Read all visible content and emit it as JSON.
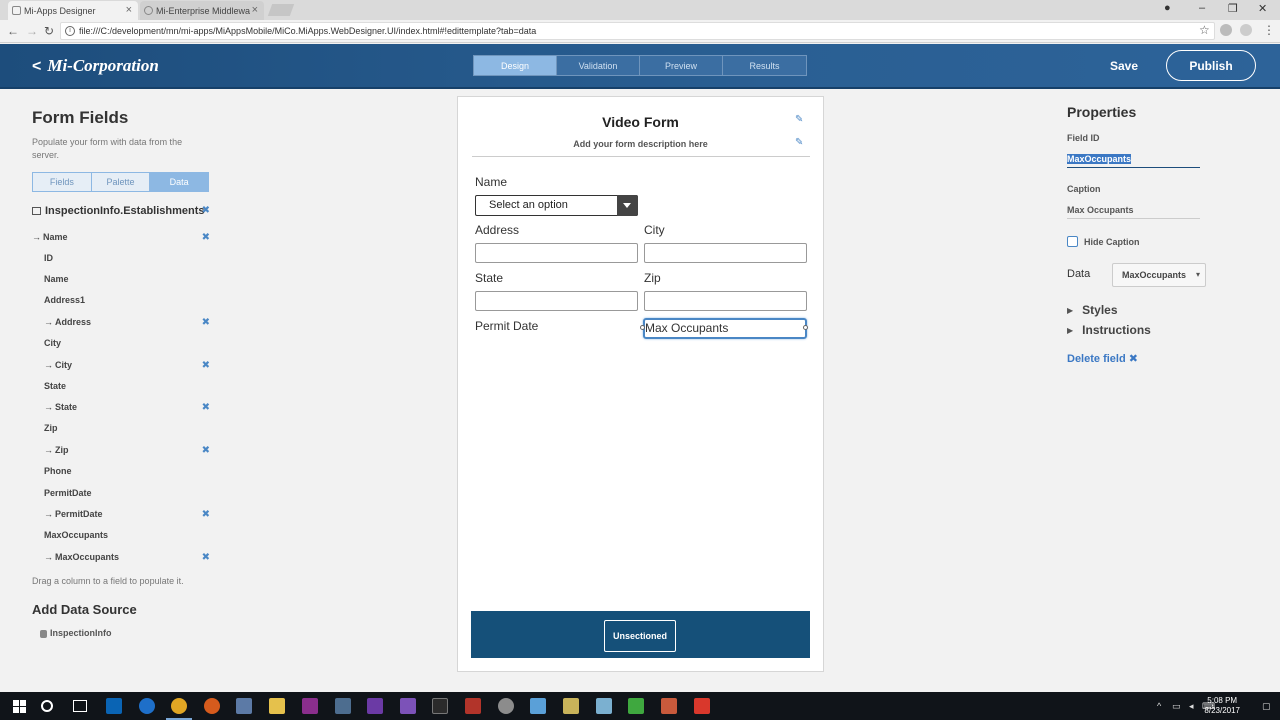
{
  "browser": {
    "tabs": [
      {
        "title": "Mi-Apps Designer"
      },
      {
        "title": "Mi-Enterprise Middlewa"
      }
    ],
    "url": "file:///C:/development/mn/mi-apps/MiAppsMobile/MiCo.MiApps.WebDesigner.UI/index.html#!edittemplate?tab=data"
  },
  "header": {
    "brand": "Mi-Corporation",
    "tabs": [
      "Design",
      "Validation",
      "Preview",
      "Results"
    ],
    "save_label": "Save",
    "publish_label": "Publish"
  },
  "left_panel": {
    "title": "Form Fields",
    "description": "Populate your form with data from the server.",
    "segments": [
      "Fields",
      "Palette",
      "Data"
    ],
    "source_root": "InspectionInfo.Establishments",
    "rows": [
      {
        "label": "Name",
        "mapped": true,
        "sub": false
      },
      {
        "label": "ID",
        "mapped": false
      },
      {
        "label": "Name",
        "mapped": false
      },
      {
        "label": "Address1",
        "mapped": false
      },
      {
        "label": "Address",
        "mapped": true,
        "sub": true
      },
      {
        "label": "City",
        "mapped": false
      },
      {
        "label": "City",
        "mapped": true,
        "sub": true
      },
      {
        "label": "State",
        "mapped": false
      },
      {
        "label": "State",
        "mapped": true,
        "sub": true
      },
      {
        "label": "Zip",
        "mapped": false
      },
      {
        "label": "Zip",
        "mapped": true,
        "sub": true
      },
      {
        "label": "Phone",
        "mapped": false
      },
      {
        "label": "PermitDate",
        "mapped": false
      },
      {
        "label": "PermitDate",
        "mapped": true,
        "sub": true
      },
      {
        "label": "MaxOccupants",
        "mapped": false
      },
      {
        "label": "MaxOccupants",
        "mapped": true,
        "sub": true
      }
    ],
    "hint": "Drag a column to a field to populate it.",
    "add_source_title": "Add Data Source",
    "source_item": "InspectionInfo"
  },
  "form": {
    "title": "Video Form",
    "description": "Add your form description here",
    "name_label": "Name",
    "select_placeholder": "Select an option",
    "address_label": "Address",
    "city_label": "City",
    "state_label": "State",
    "zip_label": "Zip",
    "permit_label": "Permit Date",
    "max_label": "Max Occupants",
    "section_label": "Unsectioned"
  },
  "properties": {
    "title": "Properties",
    "field_id_label": "Field ID",
    "field_id_value": "MaxOccupants",
    "caption_label": "Caption",
    "caption_value": "Max Occupants",
    "hide_caption_label": "Hide Caption",
    "data_label": "Data",
    "data_value": "MaxOccupants",
    "styles_label": "Styles",
    "instructions_label": "Instructions",
    "delete_label": "Delete field"
  },
  "taskbar": {
    "time": "5:08 PM",
    "date": "8/23/2017"
  },
  "colors": {
    "header": "#1d4d7c",
    "accent": "#4a87c5",
    "section_bar": "#155079"
  }
}
